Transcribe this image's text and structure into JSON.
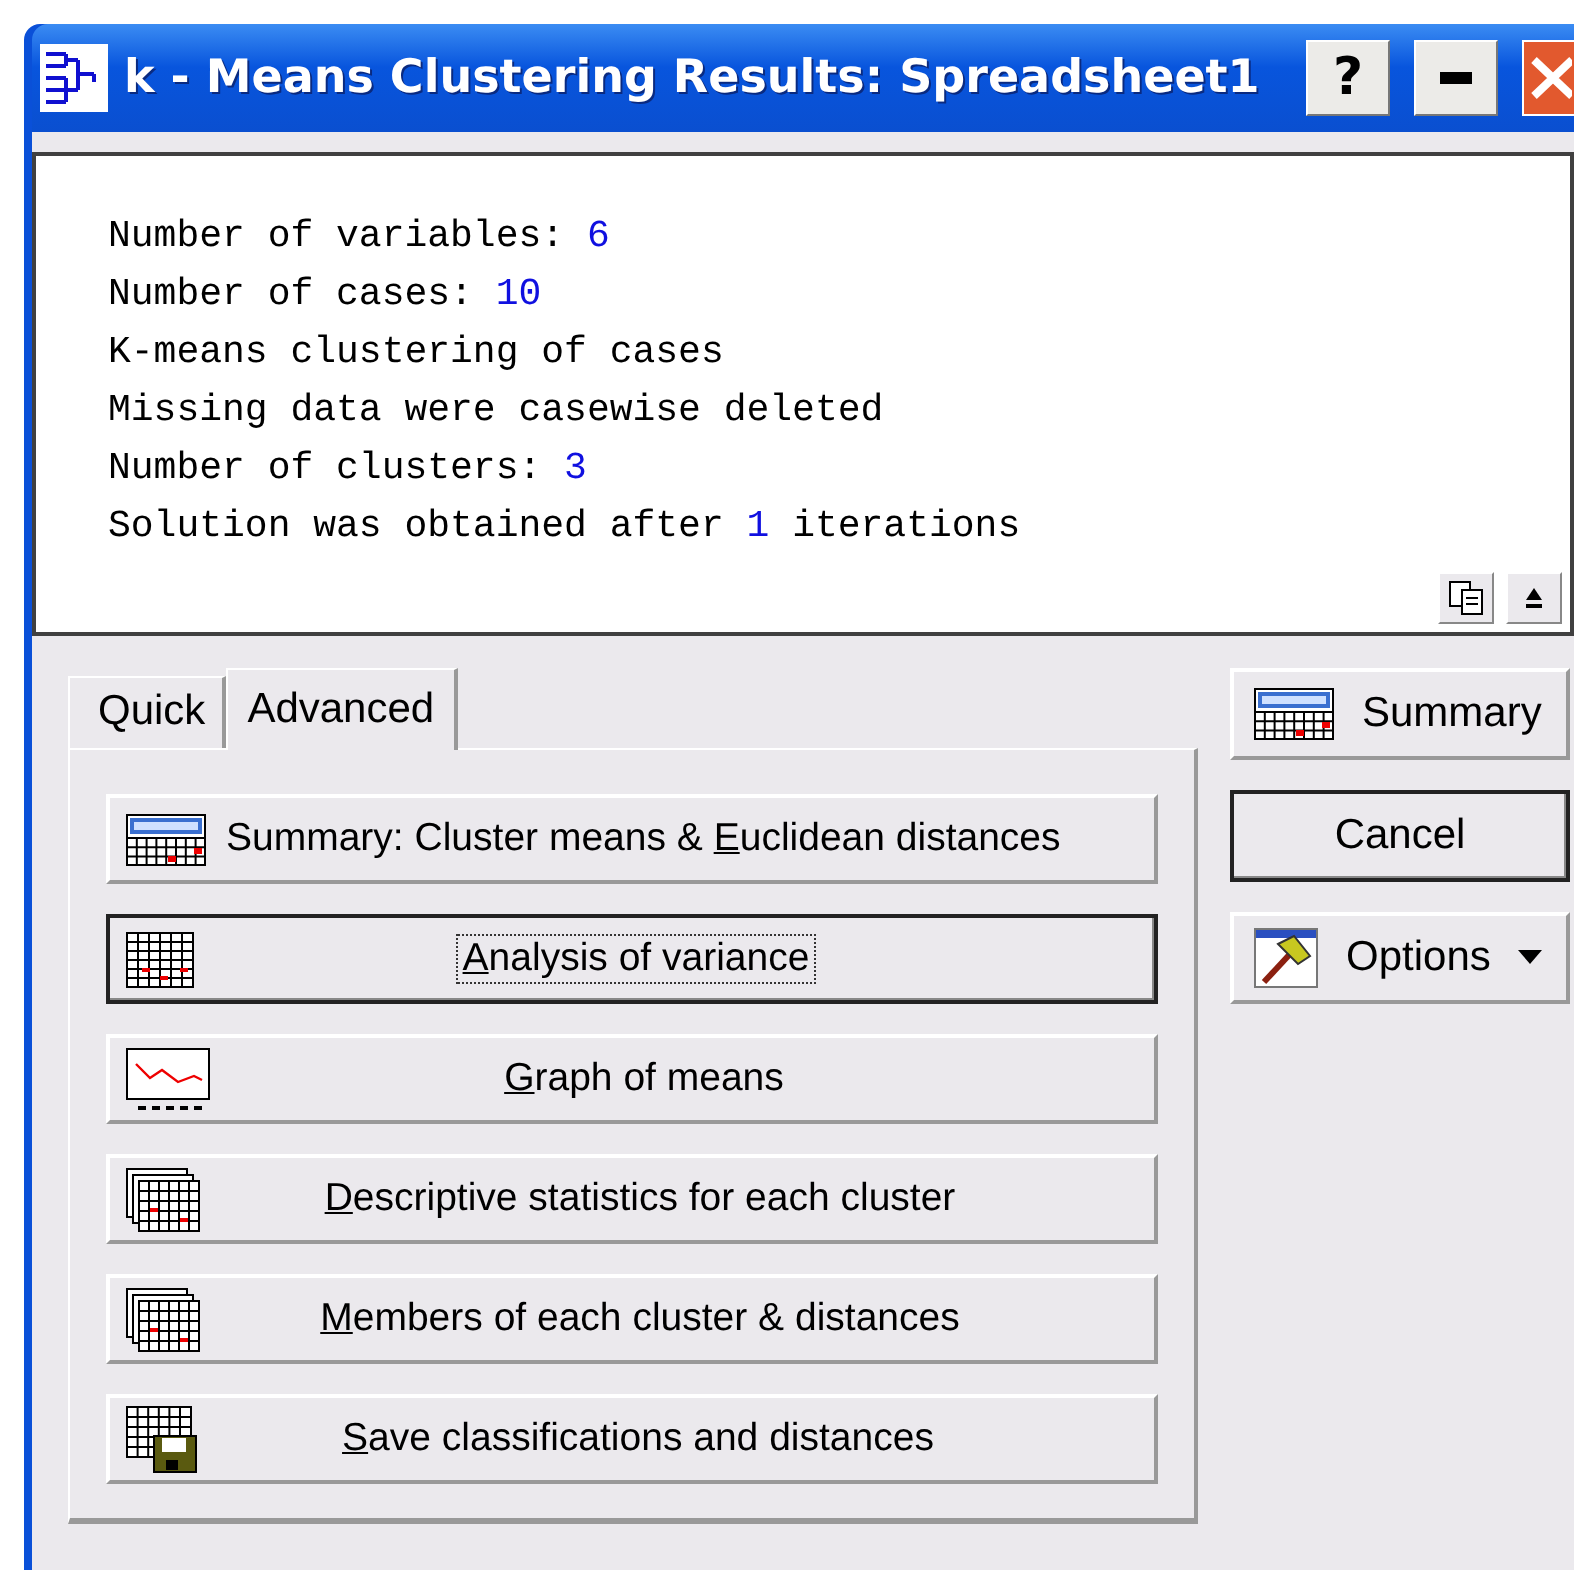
{
  "window": {
    "title": "k - Means Clustering Results: Spreadsheet1",
    "controls": [
      "?"
    ]
  },
  "output": {
    "lines": [
      {
        "parts": [
          {
            "kind": "plain",
            "text": "Number of variables: "
          },
          {
            "kind": "number",
            "text": "6"
          }
        ]
      },
      {
        "parts": [
          {
            "kind": "plain",
            "text": "Number of cases: "
          },
          {
            "kind": "number",
            "text": "10"
          }
        ]
      },
      {
        "parts": [
          {
            "kind": "plain",
            "text": "K-means clustering of cases"
          }
        ]
      },
      {
        "parts": [
          {
            "kind": "plain",
            "text": "Missing data were casewise deleted"
          }
        ]
      },
      {
        "parts": [
          {
            "kind": "plain",
            "text": "Number of clusters: "
          },
          {
            "kind": "number",
            "text": "3"
          }
        ]
      },
      {
        "parts": [
          {
            "kind": "plain",
            "text": "Solution was obtained after "
          },
          {
            "kind": "number",
            "text": "1"
          },
          {
            "kind": "plain",
            "text": " iterations"
          }
        ]
      }
    ]
  },
  "tabs": [
    {
      "label": "Quick",
      "selected": false
    },
    {
      "label": "Advanced",
      "selected": true
    }
  ],
  "actions": [
    {
      "kind": "summary",
      "pre": "Summary: Cluster means & ",
      "key": "E",
      "post": "uclidean distances",
      "focused": false
    },
    {
      "kind": "grid",
      "key": "A",
      "post": "nalysis of variance",
      "focused": true
    },
    {
      "kind": "graph",
      "key": "G",
      "post": "raph of means",
      "focused": false
    },
    {
      "kind": "sheets",
      "key": "D",
      "post": "escriptive statistics for each cluster",
      "focused": false
    },
    {
      "kind": "sheets",
      "key": "M",
      "post": "embers of each cluster & distances",
      "focused": false
    },
    {
      "kind": "save",
      "key": "S",
      "post": "ave classifications and distances",
      "focused": false
    }
  ],
  "side_buttons": [
    {
      "kind": "summary",
      "label": "Summary",
      "default": false
    },
    {
      "kind": "plain",
      "label": "Cancel",
      "default": true
    },
    {
      "kind": "options",
      "label": "Options",
      "default": false
    }
  ]
}
